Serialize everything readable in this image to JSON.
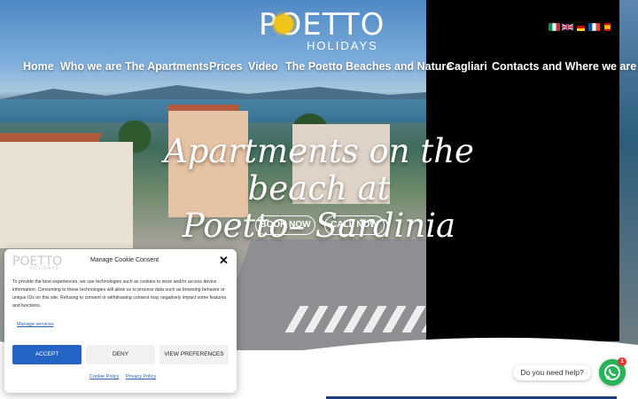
{
  "logo": {
    "word": "POETTO",
    "sub": "HOLIDAYS"
  },
  "flags": [
    "italian-flag",
    "uk-flag",
    "german-flag",
    "french-flag",
    "spanish-flag"
  ],
  "nav": {
    "items": [
      "Home",
      "Who we are",
      "The Apartments",
      "Prices",
      "Video",
      "The Poetto",
      "Beaches and Nature",
      "Cagliari",
      "Contacts and Where we are"
    ]
  },
  "hero": {
    "headline_line1": "Apartments on the beach at",
    "headline_line2": "Poetto– Sardinia",
    "book_now": "BOOK NOW",
    "call_now": "CALL NOW"
  },
  "cookie": {
    "logo_word": "POETTO",
    "logo_sub": "HOLIDAYS",
    "title": "Manage Cookie Consent",
    "close_glyph": "✕",
    "body": "To provide the best experiences, we use technologies such as cookies to store and/or access device information. Consenting to these technologies will allow us to process data such as browsing behavior or unique IDs on this site. Refusing to consent or withdrawing consent may negatively impact some features and functions.",
    "manage_services": "Manage services",
    "accept": "ACCEPT",
    "deny": "DENY",
    "view_preferences": "VIEW PREFERENCES",
    "cookie_policy": "Cookie Policy",
    "privacy_policy": "Privacy Policy"
  },
  "chat": {
    "help_text": "Do you need help?",
    "badge_count": "1"
  },
  "colors": {
    "accent_blue": "#2464c4",
    "whatsapp_green": "#25b456",
    "sun_yellow": "#f2c318"
  }
}
